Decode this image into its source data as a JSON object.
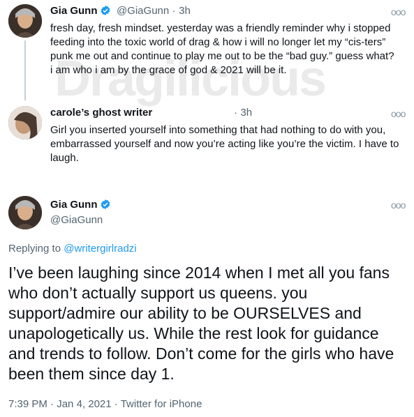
{
  "watermark": "Dragilicious",
  "tweets": [
    {
      "name": "Gia Gunn",
      "verified": true,
      "handle": "@GiaGunn",
      "separator": "·",
      "time": "3h",
      "more_icon": "ooo",
      "text": "fresh day, fresh mindset.  yesterday was a friendly reminder why i stopped feeding into the toxic world of drag & how i will no longer let my “cis-ters” punk me out and continue to play me out to be the “bad guy.” guess what? i am who i am by the grace of god & 2021 will be it."
    },
    {
      "name": "carole’s ghost writer",
      "handle": "",
      "separator": "·",
      "time": "3h",
      "more_icon": "ooo",
      "text": "Girl you inserted yourself into something that had nothing to do with you, embarrassed yourself and now you’re acting like you’re the victim. I have to laugh."
    }
  ],
  "main_tweet": {
    "name": "Gia Gunn",
    "verified": true,
    "handle": "@GiaGunn",
    "more_icon": "ooo",
    "replying_prefix": "Replying to",
    "replying_to": "@writergirlradzi",
    "text": "I’ve been laughing since 2014 when I met all you fans who don’t actually support us queens. you support/admire our ability to be OURSELVES and unapologetically us.  While the rest look for guidance and trends to follow. Don’t come for the girls who have been them since day 1.",
    "time": "7:39 PM",
    "date": "Jan 4, 2021",
    "source": "Twitter for iPhone",
    "meta_sep": "·"
  },
  "colors": {
    "link": "#1d9bf0",
    "verified": "#1d9bf0",
    "secondary_text": "#536471"
  }
}
